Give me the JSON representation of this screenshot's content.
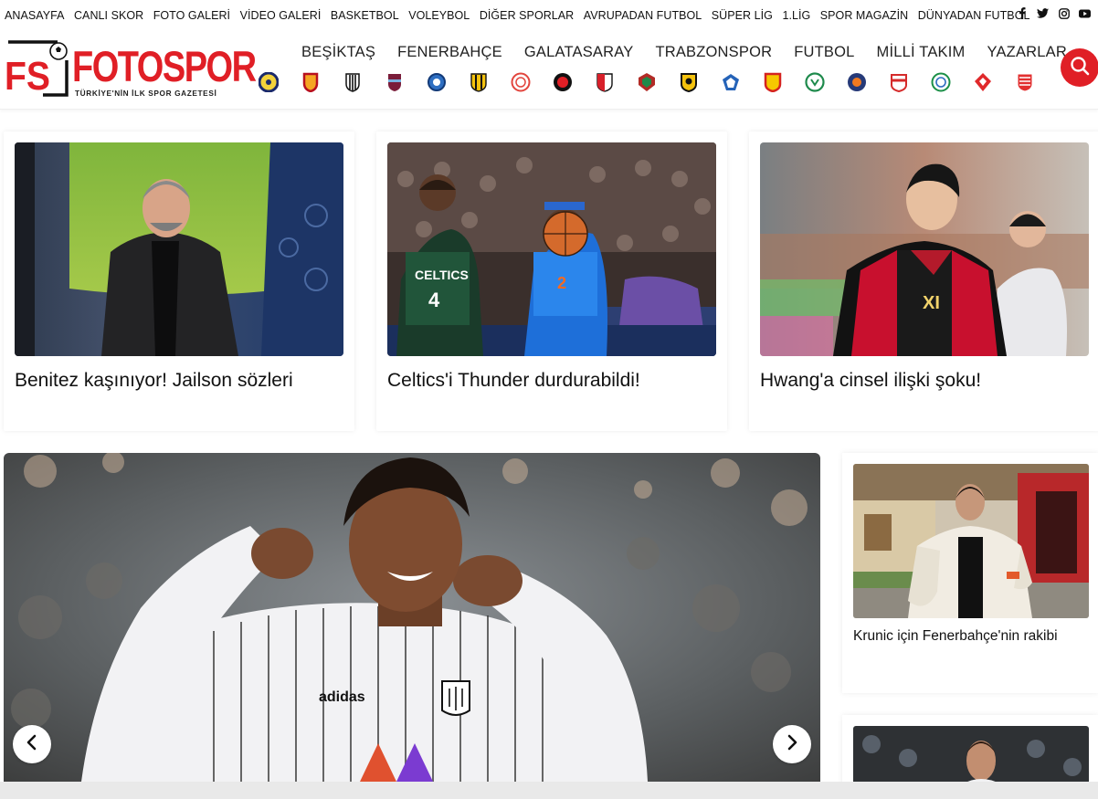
{
  "topnav": {
    "items": [
      "ANASAYFA",
      "CANLI SKOR",
      "FOTO GALERİ",
      "VİDEO GALERİ",
      "BASKETBOL",
      "VOLEYBOL",
      "DİĞER SPORLAR",
      "AVRUPADAN FUTBOL",
      "SÜPER LİG",
      "1.LİG",
      "SPOR MAGAZİN",
      "DÜNYADAN FUTBOL"
    ],
    "social": [
      "facebook-icon",
      "twitter-icon",
      "instagram-icon",
      "youtube-icon"
    ]
  },
  "logo": {
    "mark": "FS",
    "word": "FOTOSPOR",
    "tagline": "TÜRKİYE'NİN İLK SPOR GAZETESİ"
  },
  "mainnav": [
    "BEŞİKTAŞ",
    "FENERBAHÇE",
    "GALATASARAY",
    "TRABZONSPOR",
    "FUTBOL",
    "MİLLİ TAKIM",
    "YAZARLAR"
  ],
  "crests": [
    "fenerbahce-crest",
    "galatasaray-crest",
    "besiktas-crest",
    "trabzonspor-crest",
    "adana-demirspor-crest",
    "ankaragucu-crest",
    "antalyaspor-crest",
    "fatih-karagumruk-crest",
    "gaziantep-crest",
    "hatayspor-crest",
    "istanbulspor-crest",
    "kasimpasa-crest",
    "kayserispor-crest",
    "konyaspor-crest",
    "basaksehir-crest",
    "pendikspor-crest",
    "rizespor-crest",
    "samsunspor-crest",
    "sivasspor-crest"
  ],
  "colors": {
    "brand": "#e01f26",
    "text": "#111111"
  },
  "cards": [
    {
      "title": "Benitez kaşınıyor! Jailson sözleri"
    },
    {
      "title": "Celtics'i Thunder durdurabildi!"
    },
    {
      "title": "Hwang'a cinsel ilişki şoku!"
    }
  ],
  "side_cards": [
    {
      "title": "Krunic için Fenerbahçe'nin rakibi"
    },
    {
      "title": ""
    }
  ]
}
